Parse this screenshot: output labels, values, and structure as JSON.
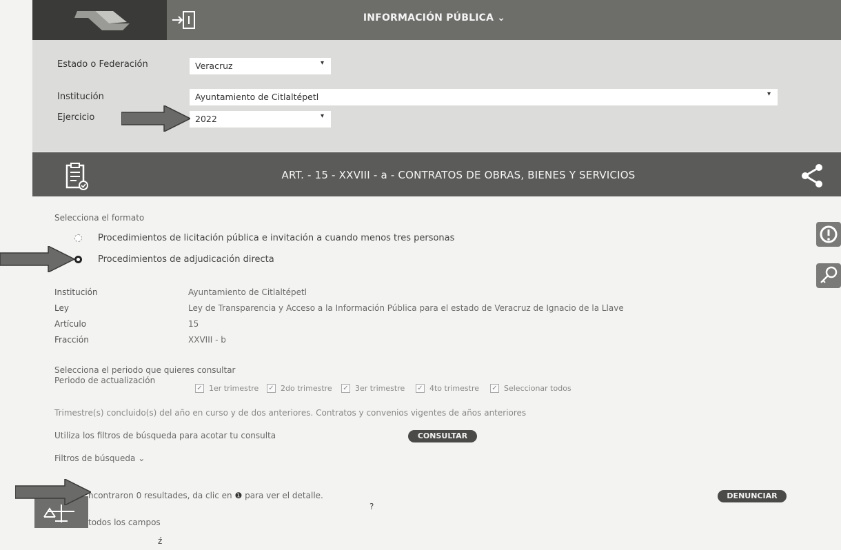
{
  "header": {
    "title": "INFORMACIÓN PÚBLICA",
    "title_caret": "⌄",
    "login_icon": "login-icon"
  },
  "filters": {
    "estado_label": "Estado o Federación",
    "estado_value": "Veracruz",
    "institucion_label": "Institución",
    "institucion_value": "Ayuntamiento de Citlaltépetl",
    "ejercicio_label": "Ejercicio",
    "ejercicio_value": "2022",
    "caret": "▾"
  },
  "section": {
    "title": "ART. - 15 - XXVIII - a - CONTRATOS DE OBRAS, BIENES Y SERVICIOS"
  },
  "formato": {
    "prompt": "Selecciona el formato",
    "options": [
      {
        "label": "Procedimientos de licitación pública e invitación a cuando menos tres personas",
        "selected": false
      },
      {
        "label": "Procedimientos de adjudicación directa",
        "selected": true
      }
    ]
  },
  "info": [
    {
      "label": "Institución",
      "value": "Ayuntamiento de Citlaltépetl"
    },
    {
      "label": "Ley",
      "value": "Ley de Transparencia y Acceso a la Información Pública para el estado de Veracruz de Ignacio de la Llave"
    },
    {
      "label": "Artículo",
      "value": "15"
    },
    {
      "label": "Fracción",
      "value": "XXVIII - b"
    }
  ],
  "periodo": {
    "prompt": "Selecciona el periodo que quieres consultar",
    "label": "Periodo de actualización",
    "options": [
      "1er trimestre",
      "2do trimestre",
      "3er trimestre",
      "4to trimestre",
      "Seleccionar todos"
    ],
    "note": "Trimestre(s) concluido(s) del año en curso y de dos anteriores. Contratos y convenios vigentes de años anteriores"
  },
  "consulta": {
    "hint": "Utiliza los filtros de búsqueda para acotar tu consulta",
    "button": "CONSULTAR",
    "filters_toggle": "Filtros de búsqueda",
    "filters_caret": "⌄"
  },
  "results": {
    "text_before": "ncontraron 0 resultades, da clic en",
    "text_after": "para ver el detalle.",
    "info_glyph": "❶",
    "fields_text": "todos los campos",
    "denounce_button": "DENUNCIAR",
    "stray_mark": "?",
    "stray_mark2": "ź"
  },
  "colors": {
    "topbar": "#6d6d6a",
    "section_bar": "#5b5b59",
    "panel": "#dcdcda",
    "button": "#4a4a48"
  }
}
